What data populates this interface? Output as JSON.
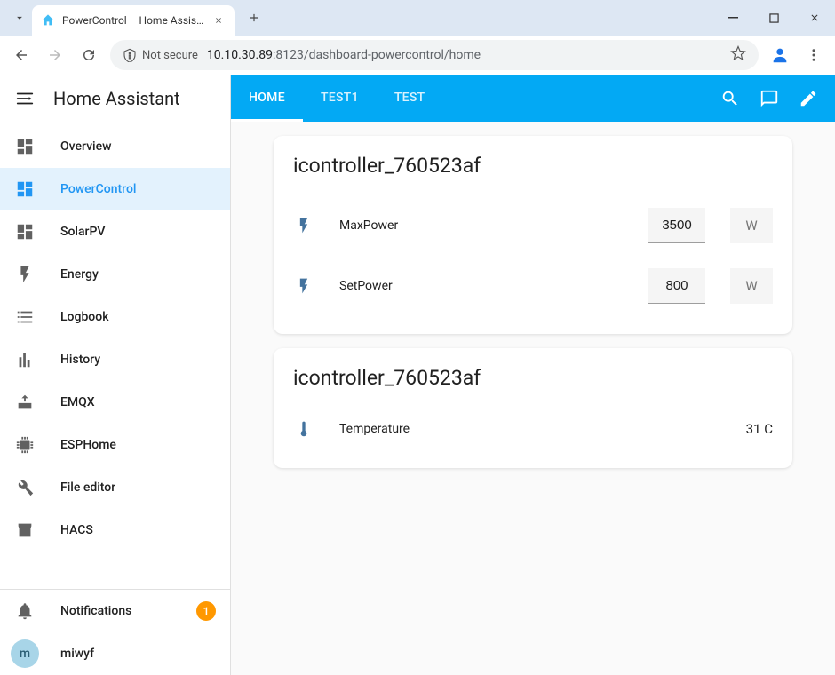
{
  "browser": {
    "tab_title": "PowerControl – Home Assista",
    "security_label": "Not secure",
    "url_host": "10.10.30.89",
    "url_port_path": ":8123/dashboard-powercontrol/home"
  },
  "brand": "Home Assistant",
  "sidebar": {
    "items": [
      {
        "label": "Overview",
        "icon": "dashboard"
      },
      {
        "label": "PowerControl",
        "icon": "dashboard",
        "active": true
      },
      {
        "label": "SolarPV",
        "icon": "dashboard"
      },
      {
        "label": "Energy",
        "icon": "flash"
      },
      {
        "label": "Logbook",
        "icon": "list"
      },
      {
        "label": "History",
        "icon": "chart"
      },
      {
        "label": "EMQX",
        "icon": "router"
      },
      {
        "label": "ESPHome",
        "icon": "chip"
      },
      {
        "label": "File editor",
        "icon": "wrench"
      },
      {
        "label": "HACS",
        "icon": "store"
      }
    ],
    "notifications_label": "Notifications",
    "notifications_count": "1",
    "user_initial": "m",
    "user_name": "miwyf"
  },
  "topbar": {
    "tabs": [
      {
        "label": "HOME",
        "active": true
      },
      {
        "label": "TEST1"
      },
      {
        "label": "TEST"
      }
    ]
  },
  "cards": [
    {
      "title": "icontroller_760523af",
      "rows": [
        {
          "icon": "flash",
          "label": "MaxPower",
          "value": "3500",
          "unit": "W",
          "editable": true
        },
        {
          "icon": "flash",
          "label": "SetPower",
          "value": "800",
          "unit": "W",
          "editable": true
        }
      ]
    },
    {
      "title": "icontroller_760523af",
      "rows": [
        {
          "icon": "thermometer",
          "label": "Temperature",
          "value": "31 C",
          "editable": false
        }
      ]
    }
  ]
}
